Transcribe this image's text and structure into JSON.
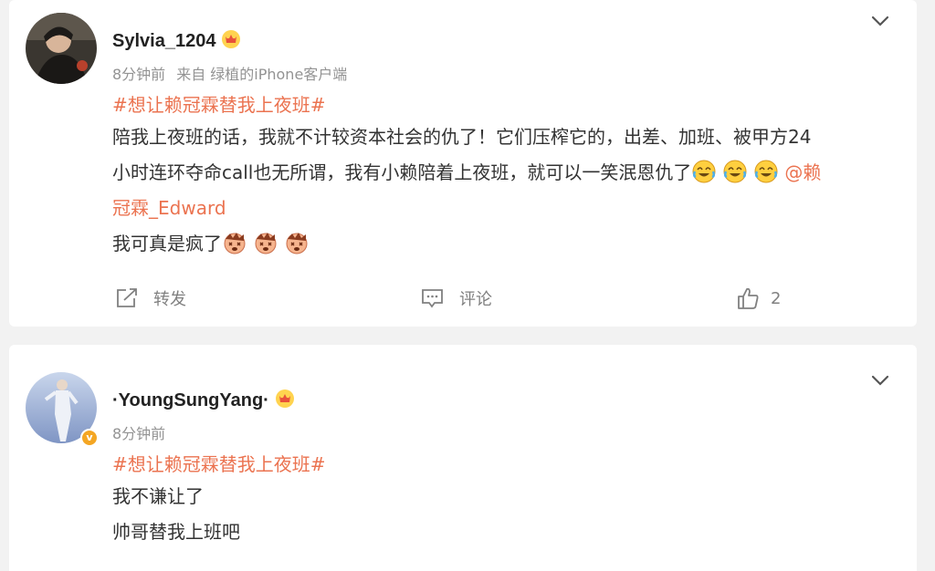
{
  "posts": [
    {
      "user": {
        "name": "Sylvia_1204",
        "crown_icon": "vip-crown-icon"
      },
      "meta": {
        "time": "8分钟前",
        "source": "来自 绿植的iPhone客户端"
      },
      "topic": "#想让赖冠霖替我上夜班#",
      "lines": [
        "陪我上夜班的话，我就不计较资本社会的仇了！它们压榨它的，出差、加班、被甲方24",
        "小时连环夺命call也无所谓，我有小赖陪着上夜班，就可以一笑泯恩仇了",
        "冠霖_Edward",
        "我可真是疯了"
      ],
      "mention_prefix": "@赖",
      "emojis_line2": [
        "laugh-cry-emoji",
        "laugh-cry-emoji",
        "laugh-cry-emoji"
      ],
      "emojis_line4": [
        "crazy-emoji",
        "crazy-emoji",
        "crazy-emoji"
      ],
      "actions": {
        "repost": "转发",
        "comment": "评论",
        "like_count": "2"
      }
    },
    {
      "user": {
        "name": "·YoungSungYang·",
        "crown_icon": "vip-crown-icon",
        "verified_badge": "v"
      },
      "meta": {
        "time": "8分钟前"
      },
      "topic": "#想让赖冠霖替我上夜班#",
      "lines": [
        "我不谦让了",
        "帅哥替我上班吧"
      ]
    }
  ],
  "colors": {
    "accent": "#eb7350",
    "meta": "#939393",
    "text": "#333333",
    "badge": "#f4a623"
  }
}
